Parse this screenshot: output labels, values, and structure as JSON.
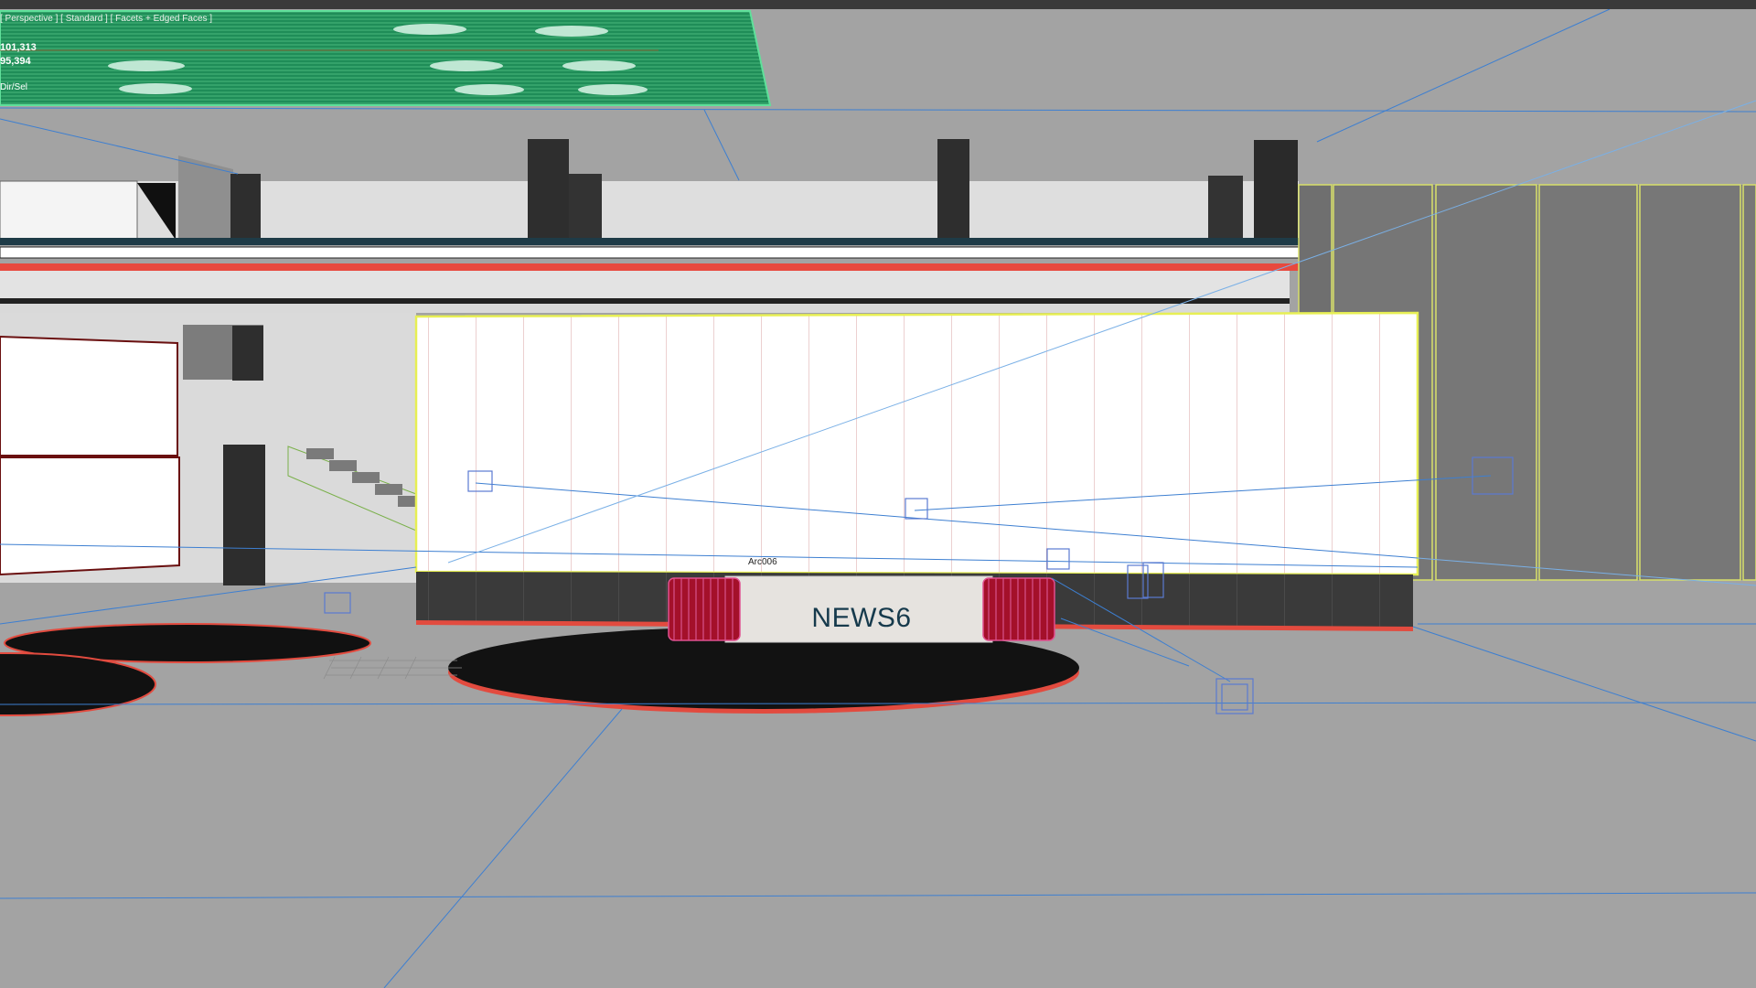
{
  "viewport": {
    "label": "[ Perspective ] [ Standard ] [ Facets + Edged Faces ]",
    "stats": [
      "101,313",
      "95,394",
      "Dir/Sel"
    ],
    "selected_object_label": "Arc006",
    "desk_logo_text": "NEWS6"
  },
  "colors": {
    "background": "#a3a3a3",
    "wireframe_blue": "#3d7fd1",
    "selection_yellow": "#e8f04a",
    "accent_red": "#e24b3f",
    "desk_red": "#b0102a",
    "floor_black": "#111111",
    "ceiling_green": "#1e8a55"
  }
}
